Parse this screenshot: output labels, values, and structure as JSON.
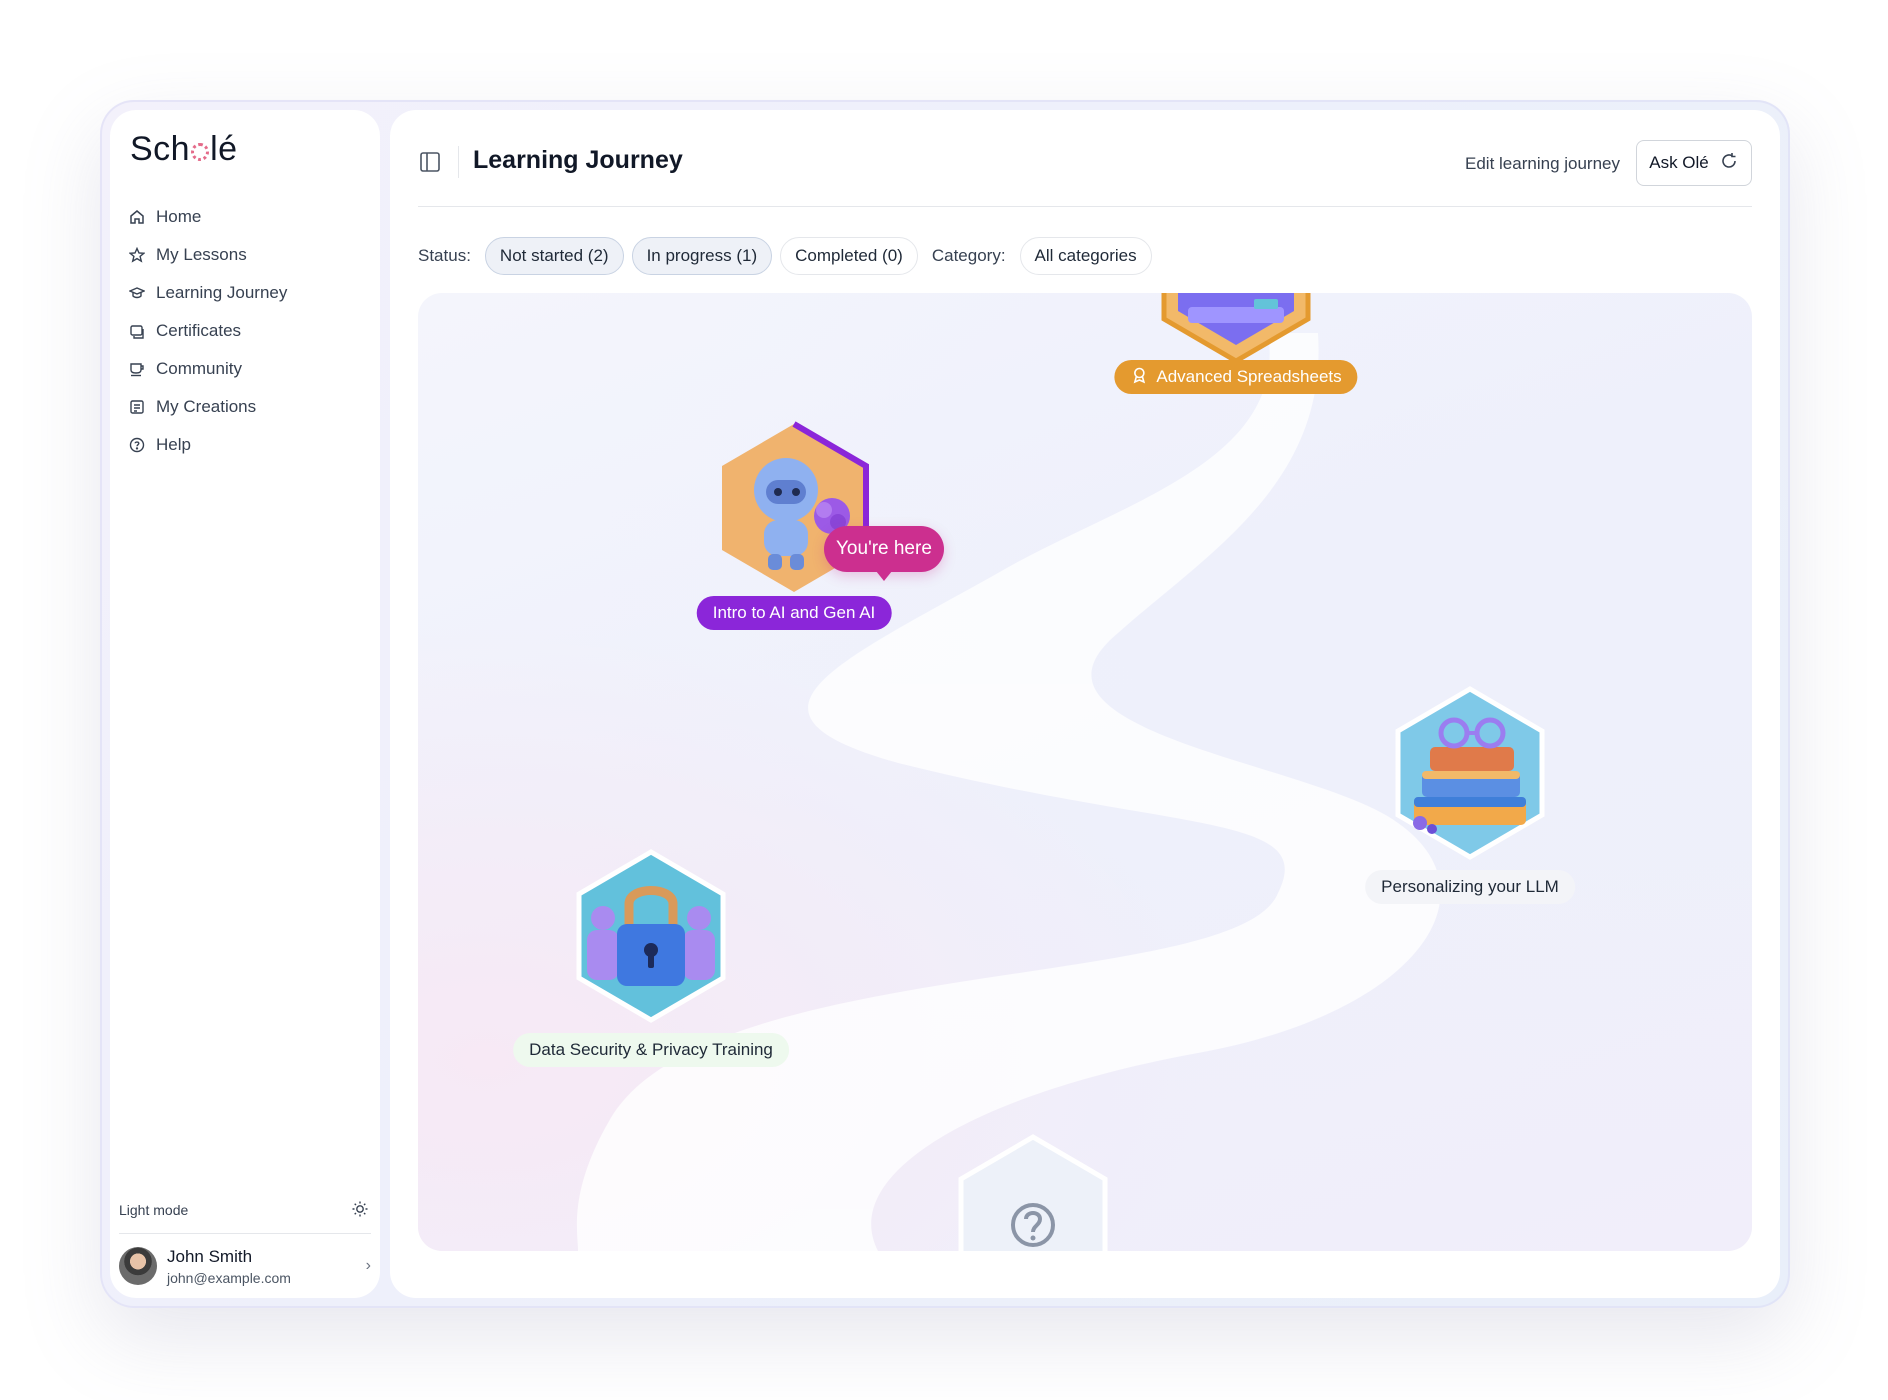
{
  "app": {
    "logo": "Schole",
    "logo_prefix": "Sch",
    "logo_suffix": "lé"
  },
  "sidebar": {
    "items": [
      {
        "label": "Home",
        "icon": "home-icon"
      },
      {
        "label": "My Lessons",
        "icon": "star-icon"
      },
      {
        "label": "Learning Journey",
        "icon": "graduation-cap-icon"
      },
      {
        "label": "Certificates",
        "icon": "certificate-icon"
      },
      {
        "label": "Community",
        "icon": "coffee-icon"
      },
      {
        "label": "My Creations",
        "icon": "document-icon"
      },
      {
        "label": "Help",
        "icon": "help-circle-icon"
      }
    ],
    "light_mode_label": "Light mode",
    "user": {
      "name": "John Smith",
      "email": "john@example.com"
    }
  },
  "header": {
    "title": "Learning Journey",
    "edit_link": "Edit learning journey",
    "ask_button": "Ask Olé"
  },
  "filters": {
    "status_label": "Status:",
    "status_chips": [
      {
        "label": "Not started (2)",
        "active": true
      },
      {
        "label": "In progress (1)",
        "active": true
      },
      {
        "label": "Completed (0)",
        "active": false
      }
    ],
    "category_label": "Category:",
    "category_value": "All categories"
  },
  "journey": {
    "nodes": [
      {
        "label": "Advanced Spreadsheets",
        "status": "completed-badge",
        "color": "#e49a2f"
      },
      {
        "label": "Intro to AI and Gen AI",
        "status": "in-progress",
        "color": "#8b26d9"
      },
      {
        "label": "Personalizing your LLM",
        "status": "not-started"
      },
      {
        "label": "Data Security & Privacy Training",
        "status": "not-started"
      },
      {
        "label": "",
        "status": "locked",
        "icon": "question-icon"
      }
    ],
    "you_are_here": "You're here"
  },
  "colors": {
    "accent_purple": "#8b26d9",
    "accent_orange": "#e49a2f",
    "accent_pink": "#cc2f8f"
  }
}
